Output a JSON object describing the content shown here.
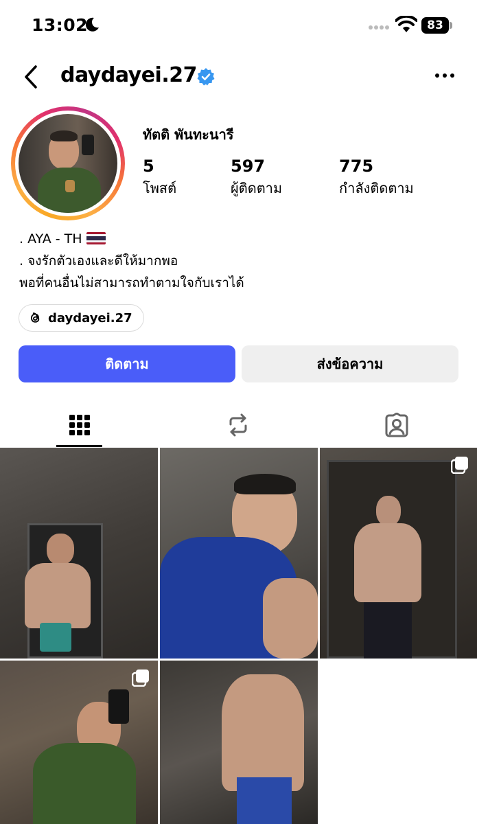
{
  "status_bar": {
    "time": "13:02",
    "battery": "83"
  },
  "header": {
    "username": "daydayei.27"
  },
  "profile": {
    "display_name": "ทัตติ พันทะนารี",
    "stats": [
      {
        "value": "5",
        "label": "โพสต์"
      },
      {
        "value": "597",
        "label": "ผู้ติดตาม"
      },
      {
        "value": "775",
        "label": "กำลังติดตาม"
      }
    ],
    "bio_lines": [
      ". AYA - TH",
      ". จงรักตัวเองและดีให้มากพอ",
      "พอที่คนอื่นไม่สามารถทำตามใจกับเราได้"
    ],
    "threads_handle": "daydayei.27"
  },
  "actions": {
    "follow": "ติดตาม",
    "message": "ส่งข้อความ"
  },
  "tabs": [
    "grid-icon",
    "reposts-icon",
    "tagged-icon"
  ],
  "posts": [
    {
      "multi": false
    },
    {
      "multi": false
    },
    {
      "multi": true
    },
    {
      "multi": true
    },
    {
      "multi": false
    }
  ],
  "colors": {
    "follow_button": "#4a5df9",
    "verified": "#3897f0",
    "message_button": "#efefef"
  }
}
